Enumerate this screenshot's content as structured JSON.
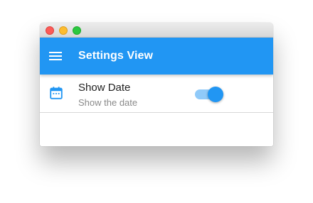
{
  "window": {
    "controls": [
      "close",
      "minimize",
      "zoom"
    ]
  },
  "appbar": {
    "menu_icon": "hamburger-menu-icon",
    "title": "Settings View",
    "color": "#2196f3"
  },
  "settings": {
    "items": [
      {
        "icon": "calendar-icon",
        "title": "Show Date",
        "subtitle": "Show the date",
        "enabled": true
      }
    ]
  },
  "colors": {
    "accent": "#2196f3",
    "toggle_track": "#90caf9",
    "close": "#fc5b57",
    "minimize": "#fdbc2e",
    "zoom": "#2bc840"
  }
}
